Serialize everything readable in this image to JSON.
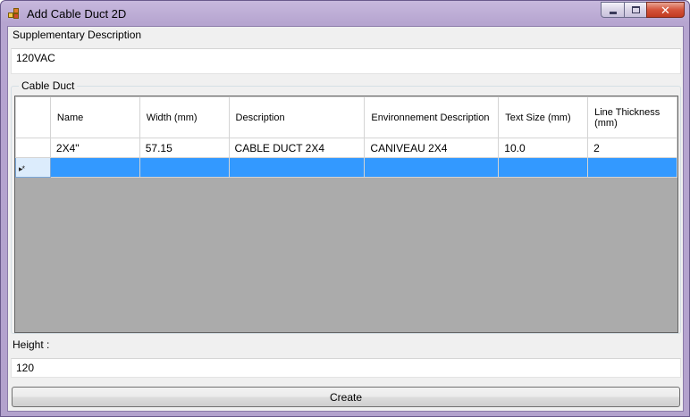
{
  "window": {
    "title": "Add Cable Duct 2D",
    "close_glyph": "✕"
  },
  "form": {
    "supp_label": "Supplementary Description",
    "supp_value": "120VAC",
    "group_title": "Cable Duct",
    "height_label": "Height :",
    "height_value": "120",
    "create_label": "Create"
  },
  "grid": {
    "columns": [
      "Name",
      "Width (mm)",
      "Description",
      "Environnement Description",
      "Text Size (mm)",
      "Line Thickness (mm)"
    ],
    "rows": [
      [
        "2X4\"",
        "57.15",
        "CABLE DUCT 2X4",
        "CANIVEAU 2X4",
        "10.0",
        "2"
      ]
    ],
    "new_row_marker": "▸*",
    "selection_color": "#3399ff",
    "empty_area_color": "#ababab"
  },
  "icons": {
    "app": "app-icon",
    "minimize": "minimize-icon",
    "maximize": "maximize-icon",
    "close": "close-icon"
  }
}
